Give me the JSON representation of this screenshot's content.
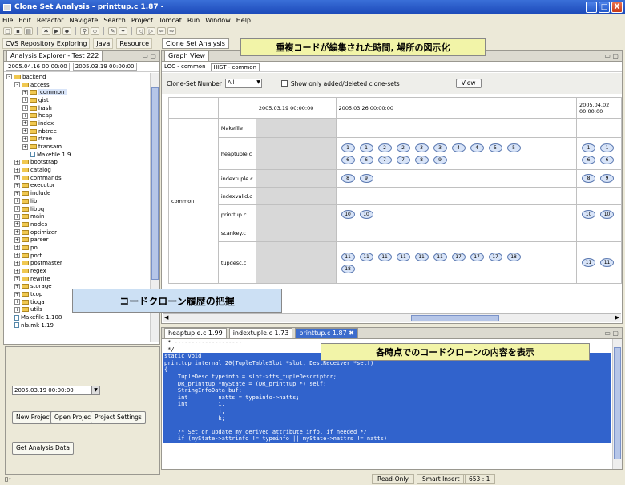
{
  "window": {
    "title": "Clone Set Analysis - printtup.c 1.87 -",
    "min": "_",
    "max": "□",
    "close": "X"
  },
  "menu": [
    "File",
    "Edit",
    "Refactor",
    "Navigate",
    "Search",
    "Project",
    "Tomcat",
    "Run",
    "Window",
    "Help"
  ],
  "perspectives": {
    "cvs": "CVS Repository Exploring",
    "java": "Java",
    "resource": "Resource",
    "clone": "Clone Set Analysis"
  },
  "explorer": {
    "tab": "Analysis Explorer - Test 222",
    "date_from": "2005.04.16 00:00:00",
    "date_to": "2005.03.19 00:00:00",
    "tree": [
      {
        "label": "backend",
        "indent": 0,
        "type": "folder",
        "exp": "-"
      },
      {
        "label": "access",
        "indent": 1,
        "type": "folder",
        "exp": "-"
      },
      {
        "label": "common",
        "indent": 2,
        "type": "folder",
        "exp": "+"
      },
      {
        "label": "gist",
        "indent": 2,
        "type": "folder",
        "exp": "+"
      },
      {
        "label": "hash",
        "indent": 2,
        "type": "folder",
        "exp": "+"
      },
      {
        "label": "heap",
        "indent": 2,
        "type": "folder",
        "exp": "+"
      },
      {
        "label": "index",
        "indent": 2,
        "type": "folder",
        "exp": "+"
      },
      {
        "label": "nbtree",
        "indent": 2,
        "type": "folder",
        "exp": "+"
      },
      {
        "label": "rtree",
        "indent": 2,
        "type": "folder",
        "exp": "+"
      },
      {
        "label": "transam",
        "indent": 2,
        "type": "folder",
        "exp": "+"
      },
      {
        "label": "Makefile 1.9",
        "indent": 3,
        "type": "file",
        "exp": ""
      },
      {
        "label": "bootstrap",
        "indent": 1,
        "type": "folder",
        "exp": "+"
      },
      {
        "label": "catalog",
        "indent": 1,
        "type": "folder",
        "exp": "+"
      },
      {
        "label": "commands",
        "indent": 1,
        "type": "folder",
        "exp": "+"
      },
      {
        "label": "executor",
        "indent": 1,
        "type": "folder",
        "exp": "+"
      },
      {
        "label": "include",
        "indent": 1,
        "type": "folder",
        "exp": "+"
      },
      {
        "label": "lib",
        "indent": 1,
        "type": "folder",
        "exp": "+"
      },
      {
        "label": "libpq",
        "indent": 1,
        "type": "folder",
        "exp": "+"
      },
      {
        "label": "main",
        "indent": 1,
        "type": "folder",
        "exp": "+"
      },
      {
        "label": "nodes",
        "indent": 1,
        "type": "folder",
        "exp": "+"
      },
      {
        "label": "optimizer",
        "indent": 1,
        "type": "folder",
        "exp": "+"
      },
      {
        "label": "parser",
        "indent": 1,
        "type": "folder",
        "exp": "+"
      },
      {
        "label": "po",
        "indent": 1,
        "type": "folder",
        "exp": "+"
      },
      {
        "label": "port",
        "indent": 1,
        "type": "folder",
        "exp": "+"
      },
      {
        "label": "postmaster",
        "indent": 1,
        "type": "folder",
        "exp": "+"
      },
      {
        "label": "regex",
        "indent": 1,
        "type": "folder",
        "exp": "+"
      },
      {
        "label": "rewrite",
        "indent": 1,
        "type": "folder",
        "exp": "+"
      },
      {
        "label": "storage",
        "indent": 1,
        "type": "folder",
        "exp": "+"
      },
      {
        "label": "tcop",
        "indent": 1,
        "type": "folder",
        "exp": "+"
      },
      {
        "label": "tioga",
        "indent": 1,
        "type": "folder",
        "exp": "+"
      },
      {
        "label": "utils",
        "indent": 1,
        "type": "folder",
        "exp": "+"
      },
      {
        "label": "Makefile 1.108",
        "indent": 1,
        "type": "file",
        "exp": ""
      },
      {
        "label": "nls.mk 1.19",
        "indent": 1,
        "type": "file",
        "exp": ""
      }
    ]
  },
  "controls": {
    "date": "2005.03.19 00:00:00",
    "new_project": "New Project",
    "open_project": "Open Project",
    "project_settings": "Project Settings",
    "get_analysis": "Get Analysis Data"
  },
  "graph": {
    "tab": "Graph View",
    "subtabs": [
      "LOC - common",
      "HIST - common"
    ],
    "clone_set_label": "Clone-Set Number",
    "clone_set_value": "All",
    "show_only": "Show only added/deleted clone-sets",
    "view_btn": "View",
    "dates": [
      "2005.03.19 00:00:00",
      "2005.03.26 00:00:00",
      "2005.04.02 00:00:00"
    ],
    "dir": "common",
    "rows": [
      {
        "file": "Makefile",
        "c1": [],
        "c2": [],
        "c3": []
      },
      {
        "file": "heaptuple.c",
        "c2": [
          [
            "1",
            "1",
            "2",
            "2",
            "3",
            "3",
            "4",
            "4",
            "5",
            "5"
          ],
          [
            "6",
            "6",
            "7",
            "7",
            "8",
            "9"
          ]
        ],
        "c3": [
          [
            "1",
            "1"
          ],
          [
            "6",
            "6"
          ]
        ]
      },
      {
        "file": "indextuple.c",
        "c2": [
          [
            "8",
            "9"
          ]
        ],
        "c3": [
          [
            "8",
            "9"
          ]
        ]
      },
      {
        "file": "indexvalid.c",
        "c2": [],
        "c3": []
      },
      {
        "file": "printtup.c",
        "c2": [
          [
            "10",
            "10"
          ]
        ],
        "c3": [
          [
            "10",
            "10"
          ]
        ]
      },
      {
        "file": "scankey.c",
        "c2": [],
        "c3": []
      },
      {
        "file": "tupdesc.c",
        "c2": [
          [
            "11",
            "11",
            "11",
            "11",
            "11",
            "11",
            "17",
            "17",
            "17",
            "18"
          ],
          [
            "18"
          ]
        ],
        "c3": [
          [
            "11",
            "11"
          ]
        ]
      }
    ]
  },
  "editor": {
    "tabs": [
      "heaptuple.c 1.99",
      "indextuple.c 1.73",
      "printtup.c 1.87"
    ],
    "lines": [
      {
        "t": " * --------------------",
        "hl": false
      },
      {
        "t": " */",
        "hl": false
      },
      {
        "t": "static void",
        "hl": true
      },
      {
        "t": "printtup_internal_20(TupleTableSlot *slot, DestReceiver *self)",
        "hl": true
      },
      {
        "t": "{",
        "hl": true
      },
      {
        "t": "    TupleDesc typeinfo = slot->tts_tupleDescriptor;",
        "hl": true
      },
      {
        "t": "    DR_printtup *myState = (DR_printtup *) self;",
        "hl": true
      },
      {
        "t": "    StringInfoData buf;",
        "hl": true
      },
      {
        "t": "    int         natts = typeinfo->natts;",
        "hl": true
      },
      {
        "t": "    int         i,",
        "hl": true
      },
      {
        "t": "                j,",
        "hl": true
      },
      {
        "t": "                k;",
        "hl": true
      },
      {
        "t": "",
        "hl": true
      },
      {
        "t": "    /* Set or update my derived attribute info, if needed */",
        "hl": true
      },
      {
        "t": "    if (myState->attrinfo != typeinfo || myState->nattrs != natts)",
        "hl": true
      }
    ]
  },
  "status": {
    "mode": "Read-Only",
    "insert": "Smart Insert",
    "pos": "653 : 1"
  },
  "callouts": {
    "top": "重複コードが編集された時間, 場所の図示化",
    "mid": "コードクローン履歴の把握",
    "bottom": "各時点でのコードクローンの内容を表示"
  }
}
